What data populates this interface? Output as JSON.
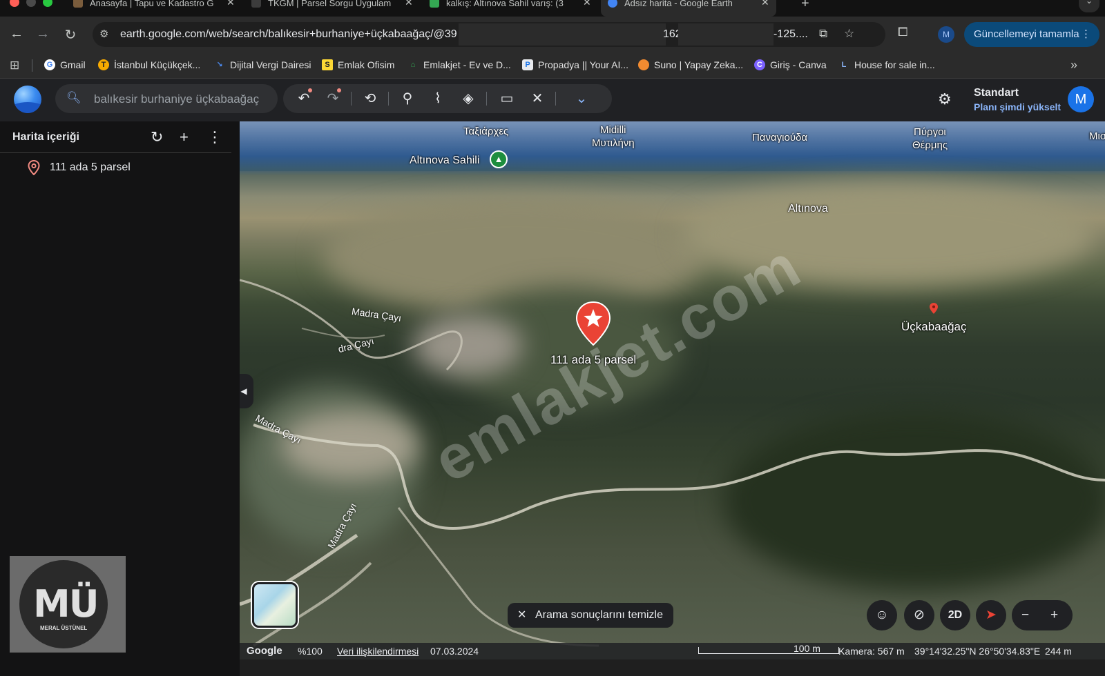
{
  "browser": {
    "tabs": [
      {
        "title": "Anasayfa | Tapu ve Kadastro G",
        "active": false
      },
      {
        "title": "TKGM | Parsel Sorgu Uygulam",
        "active": false
      },
      {
        "title": "kalkış: Altınova Sahil varış: (3",
        "active": false
      },
      {
        "title": "Adsız harita - Google Earth",
        "active": true
      }
    ],
    "url_start": "earth.google.com/web/search/balıkesir+burhaniye+üçkabaağaç/@39",
    "url_mid": "162",
    "url_end": "-125....",
    "profile_initial": "M",
    "update_label": "Güncellemeyi tamamla",
    "bookmarks": [
      {
        "label": "Gmail",
        "color": "#4285f4",
        "glyph": "G"
      },
      {
        "label": "İstanbul Küçükçek...",
        "color": "#f9ab00",
        "glyph": "T"
      },
      {
        "label": "Dijital Vergi Dairesi",
        "color": "#1a73e8",
        "glyph": "↘"
      },
      {
        "label": "Emlak Ofisim",
        "color": "#fdd835",
        "glyph": "S"
      },
      {
        "label": "Emlakjet - Ev ve D...",
        "color": "#34a853",
        "glyph": "⌂"
      },
      {
        "label": "Propadya || Your AI...",
        "color": "#e8eaed",
        "glyph": "P"
      },
      {
        "label": "Suno | Yapay Zeka...",
        "color": "#f28b30",
        "glyph": "●"
      },
      {
        "label": "Giriş - Canva",
        "color": "#7b61ff",
        "glyph": "C"
      },
      {
        "label": "House for sale in...",
        "color": "#8ab4f8",
        "glyph": "L"
      }
    ]
  },
  "earth": {
    "search_value": "balıkesir burhaniye üçkabaağaç",
    "plan_title": "Standart",
    "plan_link": "Planı şimdi yükselt",
    "avatar_initial": "M"
  },
  "sidebar": {
    "title": "Harita içeriği",
    "items": [
      {
        "label": "111 ada 5 parsel"
      }
    ],
    "logo_text": "MÜ",
    "logo_sub": "MERAL ÜSTÜNEL"
  },
  "map": {
    "labels": {
      "tagiarches": "Ταξιάρχες",
      "midilli": "Midilli",
      "mytilene": "Μυτιλήνη",
      "panagiouda": "Παναγιούδα",
      "pyrgoi_line1": "Πύργοι",
      "pyrgoi_line2": "Θέρμης",
      "mi_edge": "Μισ",
      "altinova_sahili": "Altınova Sahili",
      "altinova": "Altınova",
      "madra1": "Madra Çayı",
      "madra2": "dra Çayı",
      "madra3": "Madra Çayı",
      "madra4": "Madra Çayı",
      "parcel": "111 ada 5 parsel",
      "village": "Üçkabaağaç"
    },
    "watermark": "emlakjet.com",
    "clear_search": "Arama sonuçlarını temizle",
    "controls": {
      "mode": "2D"
    },
    "status": {
      "brand": "Google",
      "zoom": "%100",
      "data_link": "Veri ilişkilendirmesi",
      "date": "07.03.2024",
      "scale": "100 m",
      "camera": "Kamera: 567 m",
      "coords": "39°14'32.25\"N 26°50'34.83\"E",
      "elevation": "244 m"
    }
  }
}
